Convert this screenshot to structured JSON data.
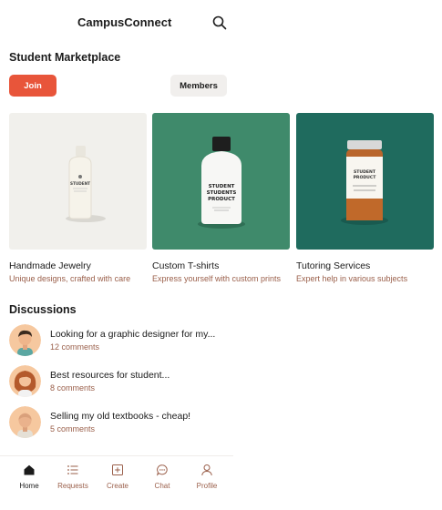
{
  "app": {
    "title": "CampusConnect"
  },
  "marketplace": {
    "title": "Student Marketplace",
    "join_label": "Join",
    "members_label": "Members",
    "accent": "#e8553a"
  },
  "cards": [
    {
      "title": "Handmade Jewelry",
      "subtitle": "Unique designs, crafted with care",
      "bg": "#f1f0ec",
      "icon": "white-bottle-product"
    },
    {
      "title": "Custom T-shirts",
      "subtitle": "Express yourself with custom prints",
      "bg": "#3f8a6b",
      "icon": "white-bottle-black-cap"
    },
    {
      "title": "Tutoring Services",
      "subtitle": "Expert help in various subjects",
      "bg": "#1f6b5e",
      "icon": "amber-jar"
    }
  ],
  "product_labels": {
    "jewelry": "STUDENT",
    "tshirt_line1": "STUDENT",
    "tshirt_line2": "STUDENTS",
    "tshirt_line3": "PRODUCT",
    "tutor_line1": "STUDENT",
    "tutor_line2": "PRODUCT"
  },
  "discussions": {
    "title": "Discussions",
    "items": [
      {
        "title": "Looking for a graphic designer for my...",
        "comments": "12 comments",
        "avatar": "man-avatar"
      },
      {
        "title": "Best resources for student...",
        "comments": "8 comments",
        "avatar": "woman-avatar"
      },
      {
        "title": "Selling my old textbooks - cheap!",
        "comments": "5 comments",
        "avatar": "bald-man-avatar"
      }
    ]
  },
  "nav": {
    "items": [
      {
        "label": "Home",
        "icon": "home-icon",
        "active": true
      },
      {
        "label": "Requests",
        "icon": "list-icon"
      },
      {
        "label": "Create",
        "icon": "plus-square-icon"
      },
      {
        "label": "Chat",
        "icon": "chat-icon"
      },
      {
        "label": "Profile",
        "icon": "user-icon"
      }
    ]
  }
}
